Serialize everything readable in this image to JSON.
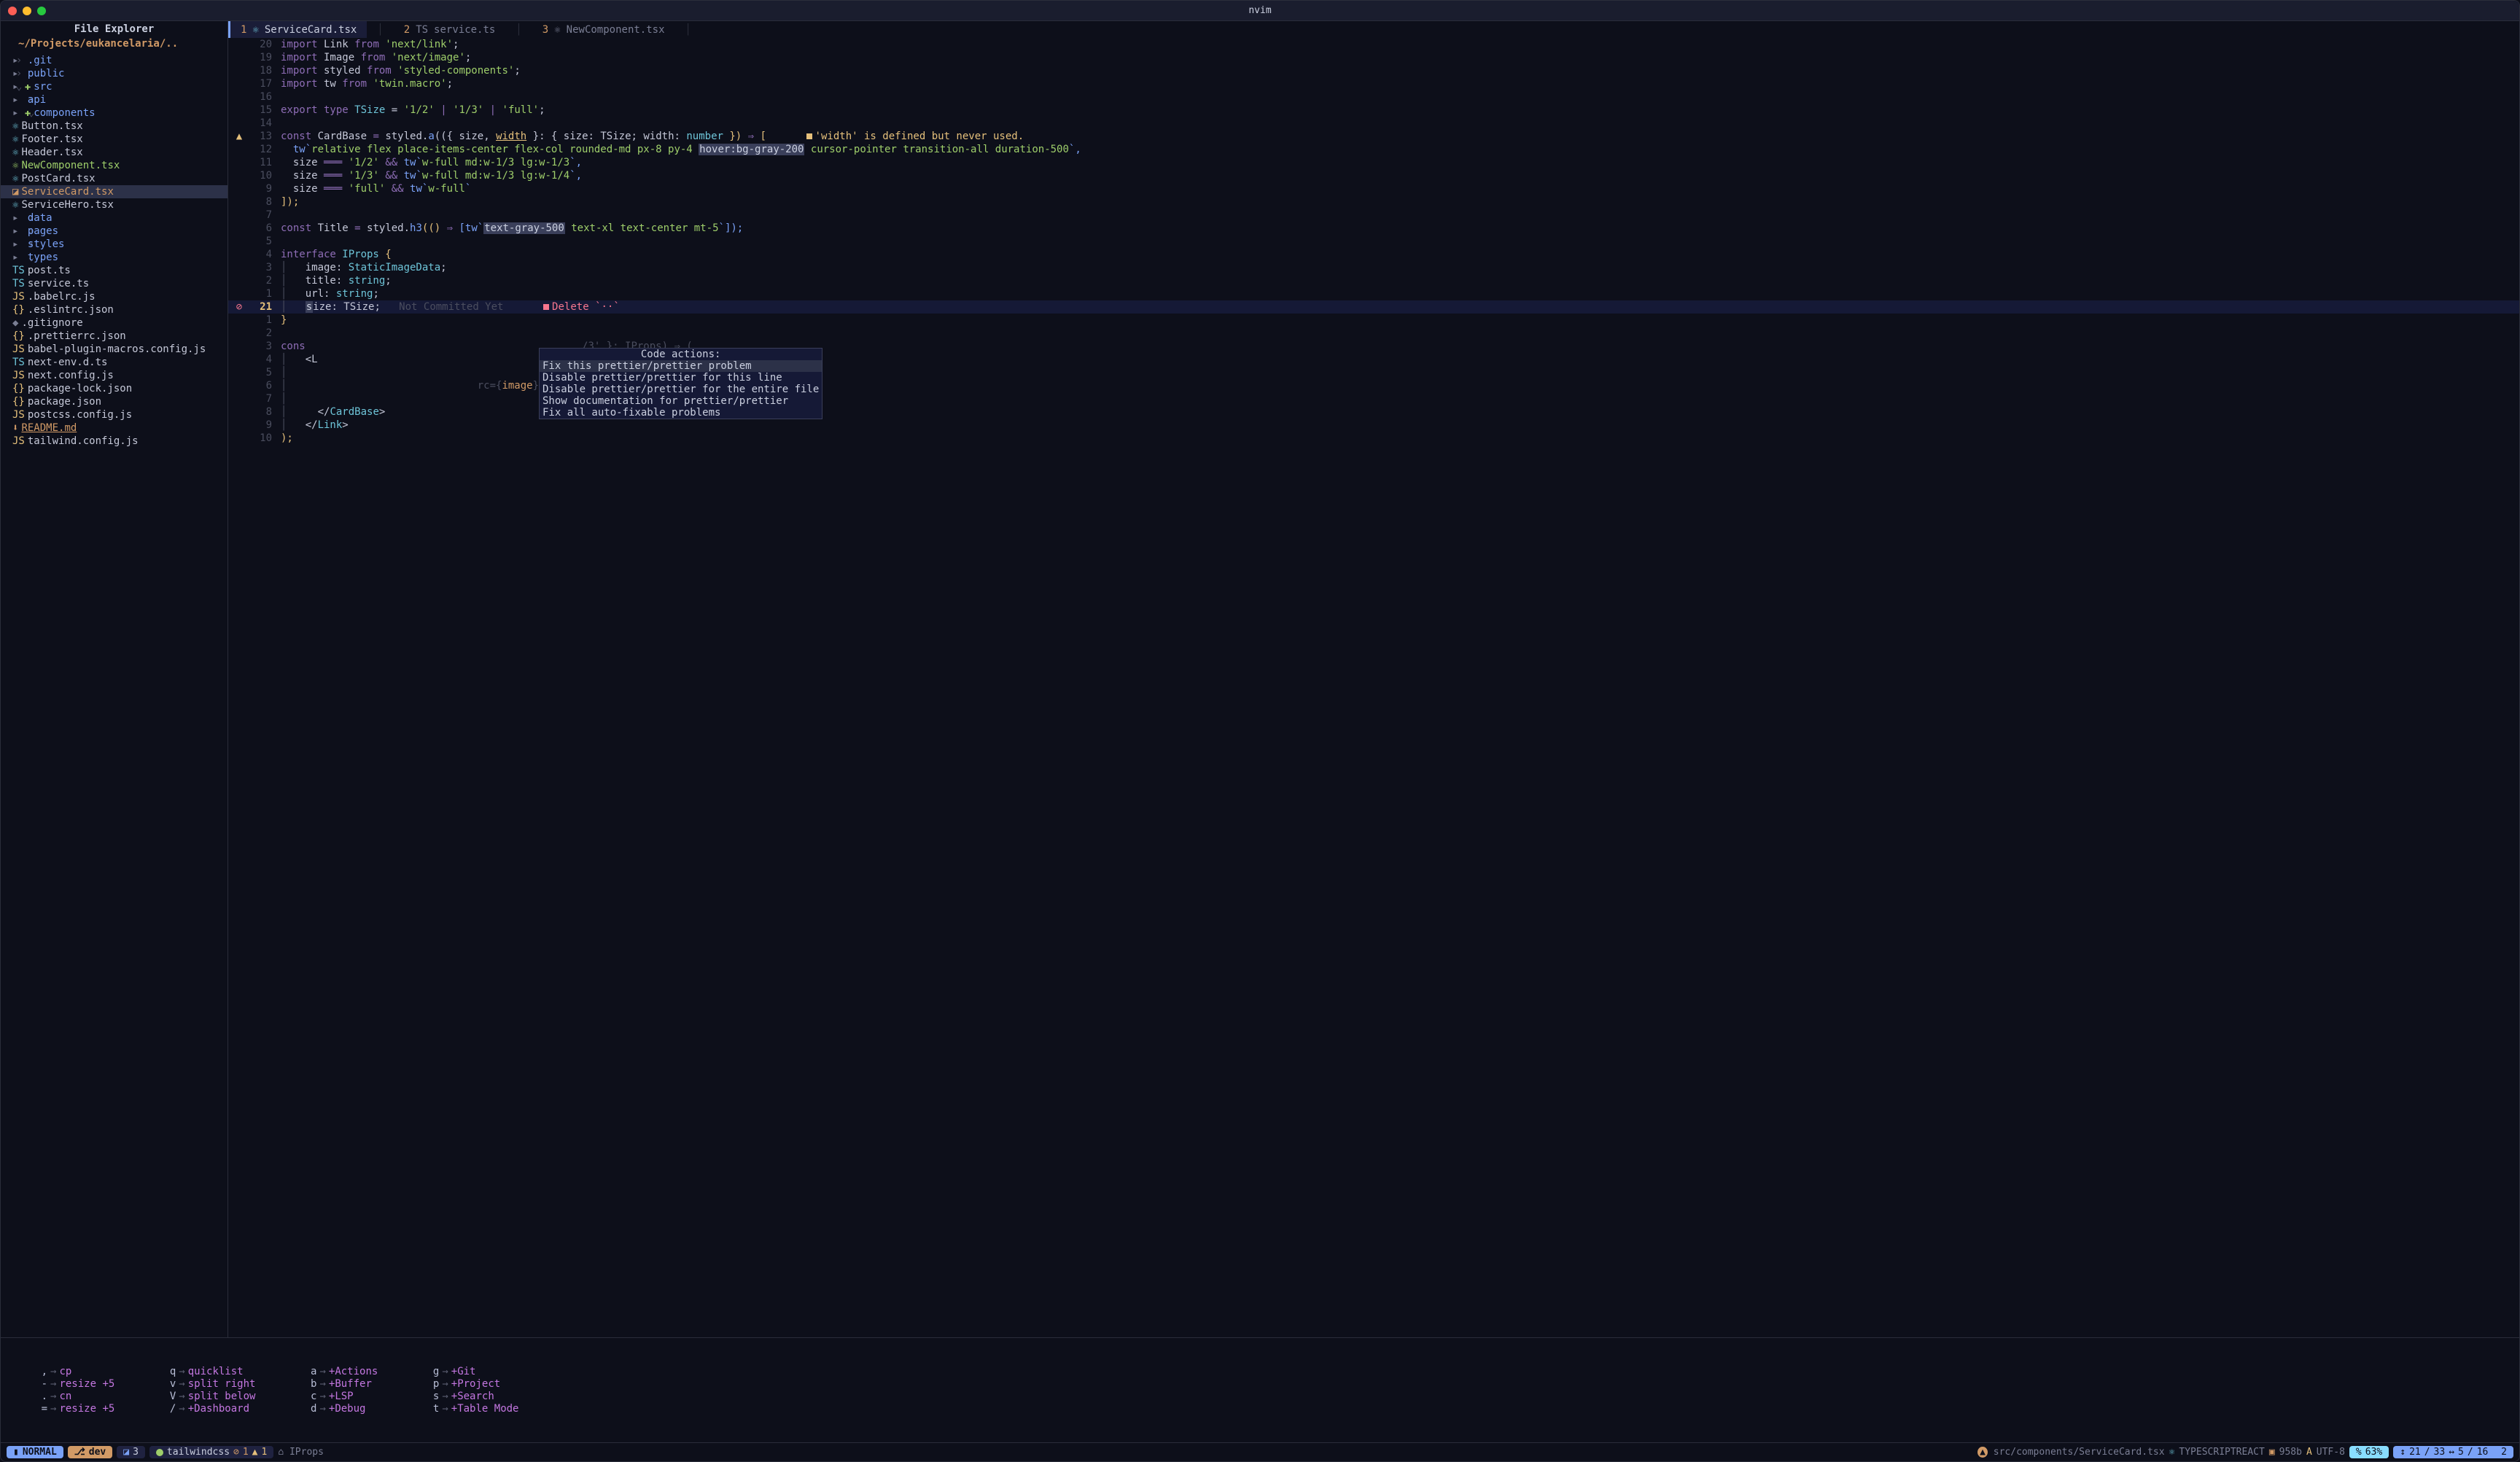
{
  "window": {
    "title": "nvim"
  },
  "sidebar": {
    "title": "File Explorer",
    "path": "~/Projects/eukancelaria/..",
    "items": [
      {
        "indent": 1,
        "arrow": "›",
        "icon": "",
        "iconcls": "c-gray",
        "name": ".git",
        "cls": "c-blue",
        "isFolder": true
      },
      {
        "indent": 1,
        "arrow": "›",
        "icon": "",
        "iconcls": "c-gray",
        "name": "public",
        "cls": "c-blue",
        "isFolder": true
      },
      {
        "indent": 1,
        "arrow": "⌄",
        "icon": "✚",
        "iconcls": "c-green",
        "name": "src",
        "cls": "c-blue",
        "isFolder": true
      },
      {
        "indent": 2,
        "arrow": "›",
        "icon": "",
        "iconcls": "c-gray",
        "name": "api",
        "cls": "c-blue",
        "isFolder": true
      },
      {
        "indent": 2,
        "arrow": "⌄",
        "icon": "✚",
        "iconcls": "c-green",
        "name": "components",
        "cls": "c-blue",
        "isFolder": true
      },
      {
        "indent": 3,
        "arrow": " ",
        "icon": "⚛",
        "iconcls": "c-cyan",
        "name": "Button.tsx",
        "cls": "c-white"
      },
      {
        "indent": 3,
        "arrow": " ",
        "icon": "⚛",
        "iconcls": "c-cyan",
        "name": "Footer.tsx",
        "cls": "c-white"
      },
      {
        "indent": 3,
        "arrow": " ",
        "icon": "⚛",
        "iconcls": "c-cyan",
        "name": "Header.tsx",
        "cls": "c-white"
      },
      {
        "indent": 3,
        "arrow": " ",
        "icon": "⚛",
        "iconcls": "c-green",
        "name": "NewComponent.tsx",
        "cls": "c-green"
      },
      {
        "indent": 3,
        "arrow": " ",
        "icon": "⚛",
        "iconcls": "c-cyan",
        "name": "PostCard.tsx",
        "cls": "c-white"
      },
      {
        "indent": 3,
        "arrow": " ",
        "icon": "◪",
        "iconcls": "c-orange",
        "name": "ServiceCard.tsx",
        "cls": "c-orange",
        "active": true
      },
      {
        "indent": 3,
        "arrow": " ",
        "icon": "⚛",
        "iconcls": "c-cyan",
        "name": "ServiceHero.tsx",
        "cls": "c-white"
      },
      {
        "indent": 2,
        "arrow": "›",
        "icon": "",
        "iconcls": "c-gray",
        "name": "data",
        "cls": "c-blue",
        "isFolder": true
      },
      {
        "indent": 2,
        "arrow": "›",
        "icon": "",
        "iconcls": "c-gray",
        "name": "pages",
        "cls": "c-blue",
        "isFolder": true
      },
      {
        "indent": 2,
        "arrow": "›",
        "icon": "",
        "iconcls": "c-gray",
        "name": "styles",
        "cls": "c-blue",
        "isFolder": true
      },
      {
        "indent": 2,
        "arrow": "⌄",
        "icon": "",
        "iconcls": "c-gray",
        "name": "types",
        "cls": "c-blue",
        "isFolder": true
      },
      {
        "indent": 3,
        "arrow": " ",
        "icon": "TS",
        "iconcls": "c-cyan",
        "name": "post.ts",
        "cls": "c-white"
      },
      {
        "indent": 3,
        "arrow": " ",
        "icon": "TS",
        "iconcls": "c-cyan",
        "name": "service.ts",
        "cls": "c-white"
      },
      {
        "indent": 1,
        "arrow": " ",
        "icon": "JS",
        "iconcls": "c-yellow",
        "name": ".babelrc.js",
        "cls": "c-white"
      },
      {
        "indent": 1,
        "arrow": " ",
        "icon": "{}",
        "iconcls": "c-yellow",
        "name": ".eslintrc.json",
        "cls": "c-white"
      },
      {
        "indent": 1,
        "arrow": " ",
        "icon": "◆",
        "iconcls": "c-gray",
        "name": ".gitignore",
        "cls": "c-white"
      },
      {
        "indent": 1,
        "arrow": " ",
        "icon": "{}",
        "iconcls": "c-yellow",
        "name": ".prettierrc.json",
        "cls": "c-white"
      },
      {
        "indent": 1,
        "arrow": " ",
        "icon": "JS",
        "iconcls": "c-yellow",
        "name": "babel-plugin-macros.config.js",
        "cls": "c-white"
      },
      {
        "indent": 1,
        "arrow": " ",
        "icon": "TS",
        "iconcls": "c-cyan",
        "name": "next-env.d.ts",
        "cls": "c-white"
      },
      {
        "indent": 1,
        "arrow": " ",
        "icon": "JS",
        "iconcls": "c-yellow",
        "name": "next.config.js",
        "cls": "c-white"
      },
      {
        "indent": 1,
        "arrow": " ",
        "icon": "{}",
        "iconcls": "c-yellow",
        "name": "package-lock.json",
        "cls": "c-white"
      },
      {
        "indent": 1,
        "arrow": " ",
        "icon": "{}",
        "iconcls": "c-yellow",
        "name": "package.json",
        "cls": "c-white"
      },
      {
        "indent": 1,
        "arrow": " ",
        "icon": "JS",
        "iconcls": "c-yellow",
        "name": "postcss.config.js",
        "cls": "c-white"
      },
      {
        "indent": 1,
        "arrow": " ",
        "icon": "⬇",
        "iconcls": "c-orange",
        "name": "README.md",
        "cls": "c-orange underl"
      },
      {
        "indent": 1,
        "arrow": " ",
        "icon": "JS",
        "iconcls": "c-yellow",
        "name": "tailwind.config.js",
        "cls": "c-white"
      }
    ]
  },
  "tabs": [
    {
      "num": "1",
      "icon": "⚛",
      "name": "ServiceCard.tsx",
      "active": true
    },
    {
      "num": "2",
      "icon": "TS",
      "name": "service.ts",
      "active": false
    },
    {
      "num": "3",
      "icon": "⚛",
      "name": "NewComponent.tsx",
      "active": false
    }
  ],
  "popup": {
    "title": "Code actions:",
    "items": [
      "Fix this prettier/prettier problem",
      "Disable prettier/prettier for this line",
      "Disable prettier/prettier for the entire file",
      "Show documentation for prettier/prettier",
      "Fix all auto-fixable problems"
    ]
  },
  "whichkey": [
    [
      {
        "k": ",",
        "d": "cp"
      },
      {
        "k": "-",
        "d": "resize +5"
      },
      {
        "k": ".",
        "d": "cn"
      },
      {
        "k": "=",
        "d": "resize +5"
      }
    ],
    [
      {
        "k": "q",
        "d": "quicklist"
      },
      {
        "k": "v",
        "d": "split right"
      },
      {
        "k": "V",
        "d": "split below"
      },
      {
        "k": "/",
        "d": "+Dashboard"
      }
    ],
    [
      {
        "k": "a",
        "d": "+Actions"
      },
      {
        "k": "b",
        "d": "+Buffer"
      },
      {
        "k": "c",
        "d": "+LSP"
      },
      {
        "k": "d",
        "d": "+Debug"
      }
    ],
    [
      {
        "k": "g",
        "d": "+Git"
      },
      {
        "k": "p",
        "d": "+Project"
      },
      {
        "k": "s",
        "d": "+Search"
      },
      {
        "k": "t",
        "d": "+Table Mode"
      }
    ]
  ],
  "status": {
    "mode": "NORMAL",
    "branch": "dev",
    "diff": "3",
    "lsp": "tailwindcss",
    "errors": "1",
    "warnings": "1",
    "context": "IProps",
    "file": "src/components/ServiceCard.tsx",
    "filetype": "TYPESCRIPTREACT",
    "size": "958b",
    "encoding": "UTF-8",
    "percent": "63%",
    "line": "21",
    "total_lines": "33",
    "col": "5",
    "total_cols": "16",
    "extra": "2"
  },
  "diag": {
    "warn": "'width' is defined but never used.",
    "delete": "Delete",
    "deletechars": "`··`",
    "blame": "Not Committed Yet"
  },
  "code": {
    "l20": {
      "a": "import",
      "b": " Link ",
      "c": "from",
      "d": " 'next/link'",
      "e": ";"
    },
    "l19": {
      "a": "import",
      "b": " Image ",
      "c": "from",
      "d": " 'next/image'",
      "e": ";"
    },
    "l18": {
      "a": "import",
      "b": " styled ",
      "c": "from",
      "d": " 'styled-components'",
      "e": ";"
    },
    "l17": {
      "a": "import",
      "b": " tw ",
      "c": "from",
      "d": " 'twin.macro'",
      "e": ";"
    },
    "l15": {
      "a": "export",
      "b": " type ",
      "c": "TSize",
      "d": " = ",
      "e": "'1/2'",
      "f": " | ",
      "g": "'1/3'",
      "h": " | ",
      "i": "'full'",
      "j": ";"
    },
    "l13": {
      "a": "const",
      "b": " CardBase ",
      "c": "=",
      "d": " styled.",
      "e": "a",
      "f": "(({ size, ",
      "g": "width",
      "h": " }: { size: TSize; width: ",
      "i": "number",
      "j": " }) ",
      "k": "⇒",
      "l": " ["
    },
    "l12": {
      "a": "  tw`",
      "b": "relative flex place-items-center flex-col rounded-md px-8 py-4 ",
      "c": "hover:bg-gray-200",
      "d": " cursor-pointer transition-all duration-500",
      "e": "`,"
    },
    "l11": {
      "a": "  size ",
      "b": "═══",
      "c": " '1/2' ",
      "d": "&&",
      "e": " tw`",
      "f": "w-full md:w-1/3 lg:w-1/3",
      "g": "`,"
    },
    "l10": {
      "a": "  size ",
      "b": "═══",
      "c": " '1/3' ",
      "d": "&&",
      "e": " tw`",
      "f": "w-full md:w-1/3 lg:w-1/4",
      "g": "`,"
    },
    "l9": {
      "a": "  size ",
      "b": "═══",
      "c": " 'full' ",
      "d": "&&",
      "e": " tw`",
      "f": "w-full",
      "g": "`"
    },
    "l8": {
      "a": "]);"
    },
    "l6": {
      "a": "const",
      "b": " Title ",
      "c": "=",
      "d": " styled.",
      "e": "h3",
      "f": "(() ",
      "g": "⇒",
      "h": " [tw`",
      "i": "text-gray-500",
      "j": " text-xl text-center mt-5",
      "k": "`]);"
    },
    "l4": {
      "a": "interface",
      "b": " IProps ",
      "c": "{"
    },
    "l3a": {
      "a": "  image: ",
      "b": "StaticImageData",
      "c": ";"
    },
    "l2a": {
      "a": "  title: ",
      "b": "string",
      "c": ";"
    },
    "l1a": {
      "a": "  url: ",
      "b": "string",
      "c": ";"
    },
    "l21": {
      "a": "  ",
      "b": "s",
      "c": "ize: TSize;"
    },
    "l1b": {
      "a": "}"
    },
    "l3b": {
      "a": "cons",
      "dim": "                                             /3' }: IProps) ⇒ ("
    },
    "l4b": {
      "a": "  <L"
    },
    "l5b": {
      "dim": ""
    },
    "l6b": {
      "dim": "                              rc={",
      "b": "image",
      "c": "} />"
    },
    "l8b": {
      "a": "    </",
      "b": "CardBase",
      "c": ">"
    },
    "l9b": {
      "a": "  </",
      "b": "Link",
      "c": ">"
    },
    "l10b": {
      "a": ");"
    }
  },
  "gutnums": [
    "20",
    "19",
    "18",
    "17",
    "16",
    "15",
    "14",
    "13",
    "12",
    "11",
    "10",
    "9",
    "8",
    "7",
    "6",
    "5",
    "4",
    "3",
    "2",
    "1",
    "21",
    "1",
    "2",
    "3",
    "4",
    "5",
    "6",
    "7",
    "8",
    "9",
    "10"
  ]
}
